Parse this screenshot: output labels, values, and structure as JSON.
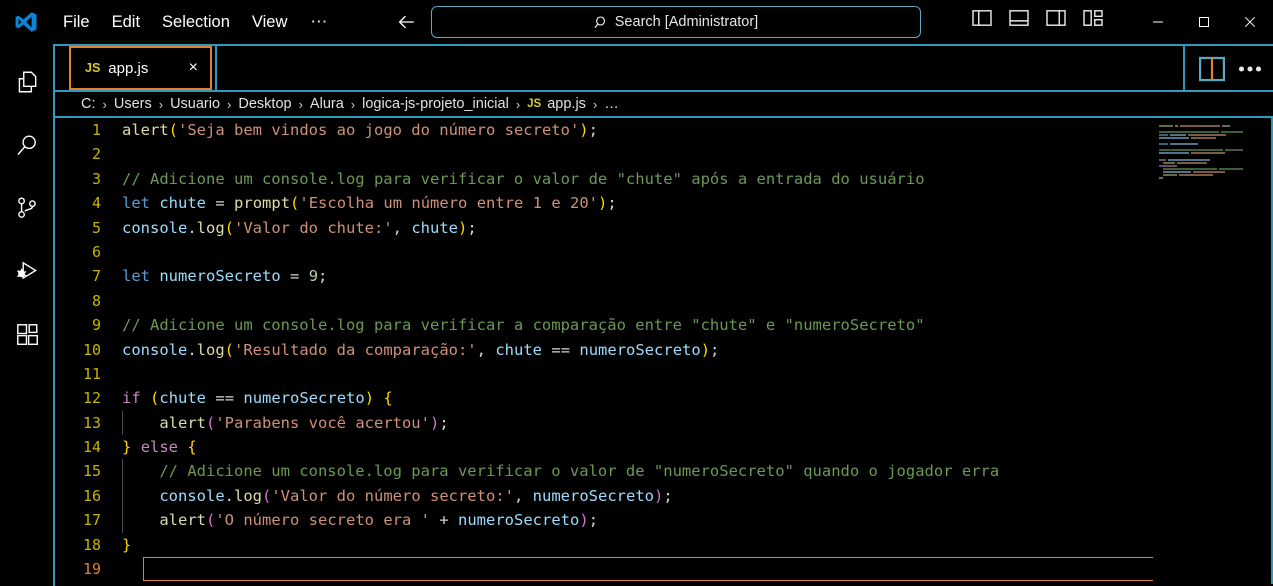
{
  "titlebar": {
    "logo_icon": "vscode-logo-icon",
    "menus": [
      "File",
      "Edit",
      "Selection",
      "View",
      "⋯"
    ],
    "nav_back_icon": "arrow-left-icon",
    "nav_forward_icon": "arrow-right-icon",
    "search": {
      "icon": "search-icon",
      "text": "Search [Administrator]"
    },
    "layout_buttons": [
      "toggle-primary-sidebar-icon",
      "toggle-panel-icon",
      "toggle-secondary-sidebar-icon",
      "customize-layout-icon"
    ],
    "window_controls": [
      "minimize-icon",
      "maximize-icon",
      "close-icon"
    ]
  },
  "activitybar": {
    "items": [
      {
        "name": "explorer",
        "icon": "files-icon"
      },
      {
        "name": "search",
        "icon": "search-icon"
      },
      {
        "name": "source-control",
        "icon": "source-control-icon"
      },
      {
        "name": "run-and-debug",
        "icon": "run-debug-icon"
      },
      {
        "name": "extensions",
        "icon": "extensions-icon"
      }
    ]
  },
  "tabs": [
    {
      "icon_label": "JS",
      "label": "app.js",
      "close_label": "×",
      "active": true
    }
  ],
  "tab_actions": {
    "split_editor_icon": "split-editor-icon",
    "more_actions_icon": "more-actions-icon",
    "more_actions_label": "⋯"
  },
  "breadcrumbs": {
    "items": [
      "C:",
      "Users",
      "Usuario",
      "Desktop",
      "Alura",
      "logica-js-projeto_inicial",
      "app.js",
      "…"
    ],
    "file_icon_label": "JS",
    "separator": "›"
  },
  "editor": {
    "language": "javascript",
    "active_line": 19,
    "total_lines": 19,
    "lines": [
      {
        "n": 1,
        "text": "alert('Seja bem vindos ao jogo do número secreto');"
      },
      {
        "n": 2,
        "text": ""
      },
      {
        "n": 3,
        "text": "// Adicione um console.log para verificar o valor de \"chute\" após a entrada do usuário"
      },
      {
        "n": 4,
        "text": "let chute = prompt('Escolha um número entre 1 e 20');"
      },
      {
        "n": 5,
        "text": "console.log('Valor do chute:', chute);"
      },
      {
        "n": 6,
        "text": ""
      },
      {
        "n": 7,
        "text": "let numeroSecreto = 9;"
      },
      {
        "n": 8,
        "text": ""
      },
      {
        "n": 9,
        "text": "// Adicione um console.log para verificar a comparação entre \"chute\" e \"numeroSecreto\""
      },
      {
        "n": 10,
        "text": "console.log('Resultado da comparação:', chute == numeroSecreto);"
      },
      {
        "n": 11,
        "text": ""
      },
      {
        "n": 12,
        "text": "if (chute == numeroSecreto) {"
      },
      {
        "n": 13,
        "text": "    alert('Parabens você acertou');"
      },
      {
        "n": 14,
        "text": "} else {"
      },
      {
        "n": 15,
        "text": "    // Adicione um console.log para verificar o valor de \"numeroSecreto\" quando o jogador erra"
      },
      {
        "n": 16,
        "text": "    console.log('Valor do número secreto:', numeroSecreto);"
      },
      {
        "n": 17,
        "text": "    alert('O número secreto era ' + numeroSecreto);"
      },
      {
        "n": 18,
        "text": "}"
      },
      {
        "n": 19,
        "text": ""
      }
    ]
  },
  "colors": {
    "background": "#000000",
    "border_accent": "#2e9bbd",
    "active_tab_border": "#e08030",
    "current_line_border": "#e08030",
    "line_number": "#c8b400",
    "active_line_number": "#e08030",
    "comment": "#6a9955",
    "string": "#ce9178",
    "keyword": "#569cd6",
    "function": "#dcdcaa",
    "variable": "#9cdcfe",
    "number": "#b5cea8",
    "control_keyword": "#c586c0",
    "bracket_1": "#ffd700",
    "bracket_2": "#da70d6",
    "bracket_3": "#179fff",
    "foreground": "#ffffff"
  }
}
